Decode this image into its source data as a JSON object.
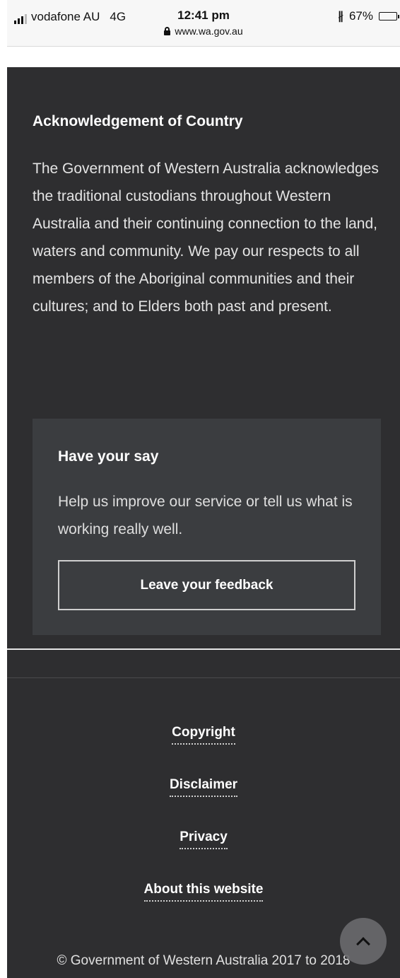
{
  "status_bar": {
    "carrier": "vodafone AU",
    "network": "4G",
    "time": "12:41 pm",
    "url": "www.wa.gov.au",
    "battery": "67%",
    "battery_level": 0.67,
    "icons": [
      "signal-icon",
      "lock-icon",
      "bluetooth-icon",
      "battery-icon"
    ]
  },
  "acknowledgement": {
    "title": "Acknowledgement of Country",
    "body": "The Government of Western Australia acknowledges the traditional custodians throughout Western Australia and their continuing connection to the land, waters and community. We pay our respects to all members of the Aboriginal communities and their cultures; and to Elders both past and present."
  },
  "have_your_say": {
    "title": "Have your say",
    "body": "Help us improve our service or tell us what is working really well.",
    "button_label": "Leave your feedback"
  },
  "footer": {
    "links": [
      {
        "label": "Copyright"
      },
      {
        "label": "Disclaimer"
      },
      {
        "label": "Privacy"
      },
      {
        "label": "About this website"
      }
    ],
    "copyright": "© Government of Western Australia 2017 to 2018"
  },
  "back_to_top": {
    "icon": "chevron-up-icon"
  },
  "colors": {
    "page_background": "#2e2e30",
    "panel_background": "#3b3d40",
    "text": "#ffffff"
  }
}
